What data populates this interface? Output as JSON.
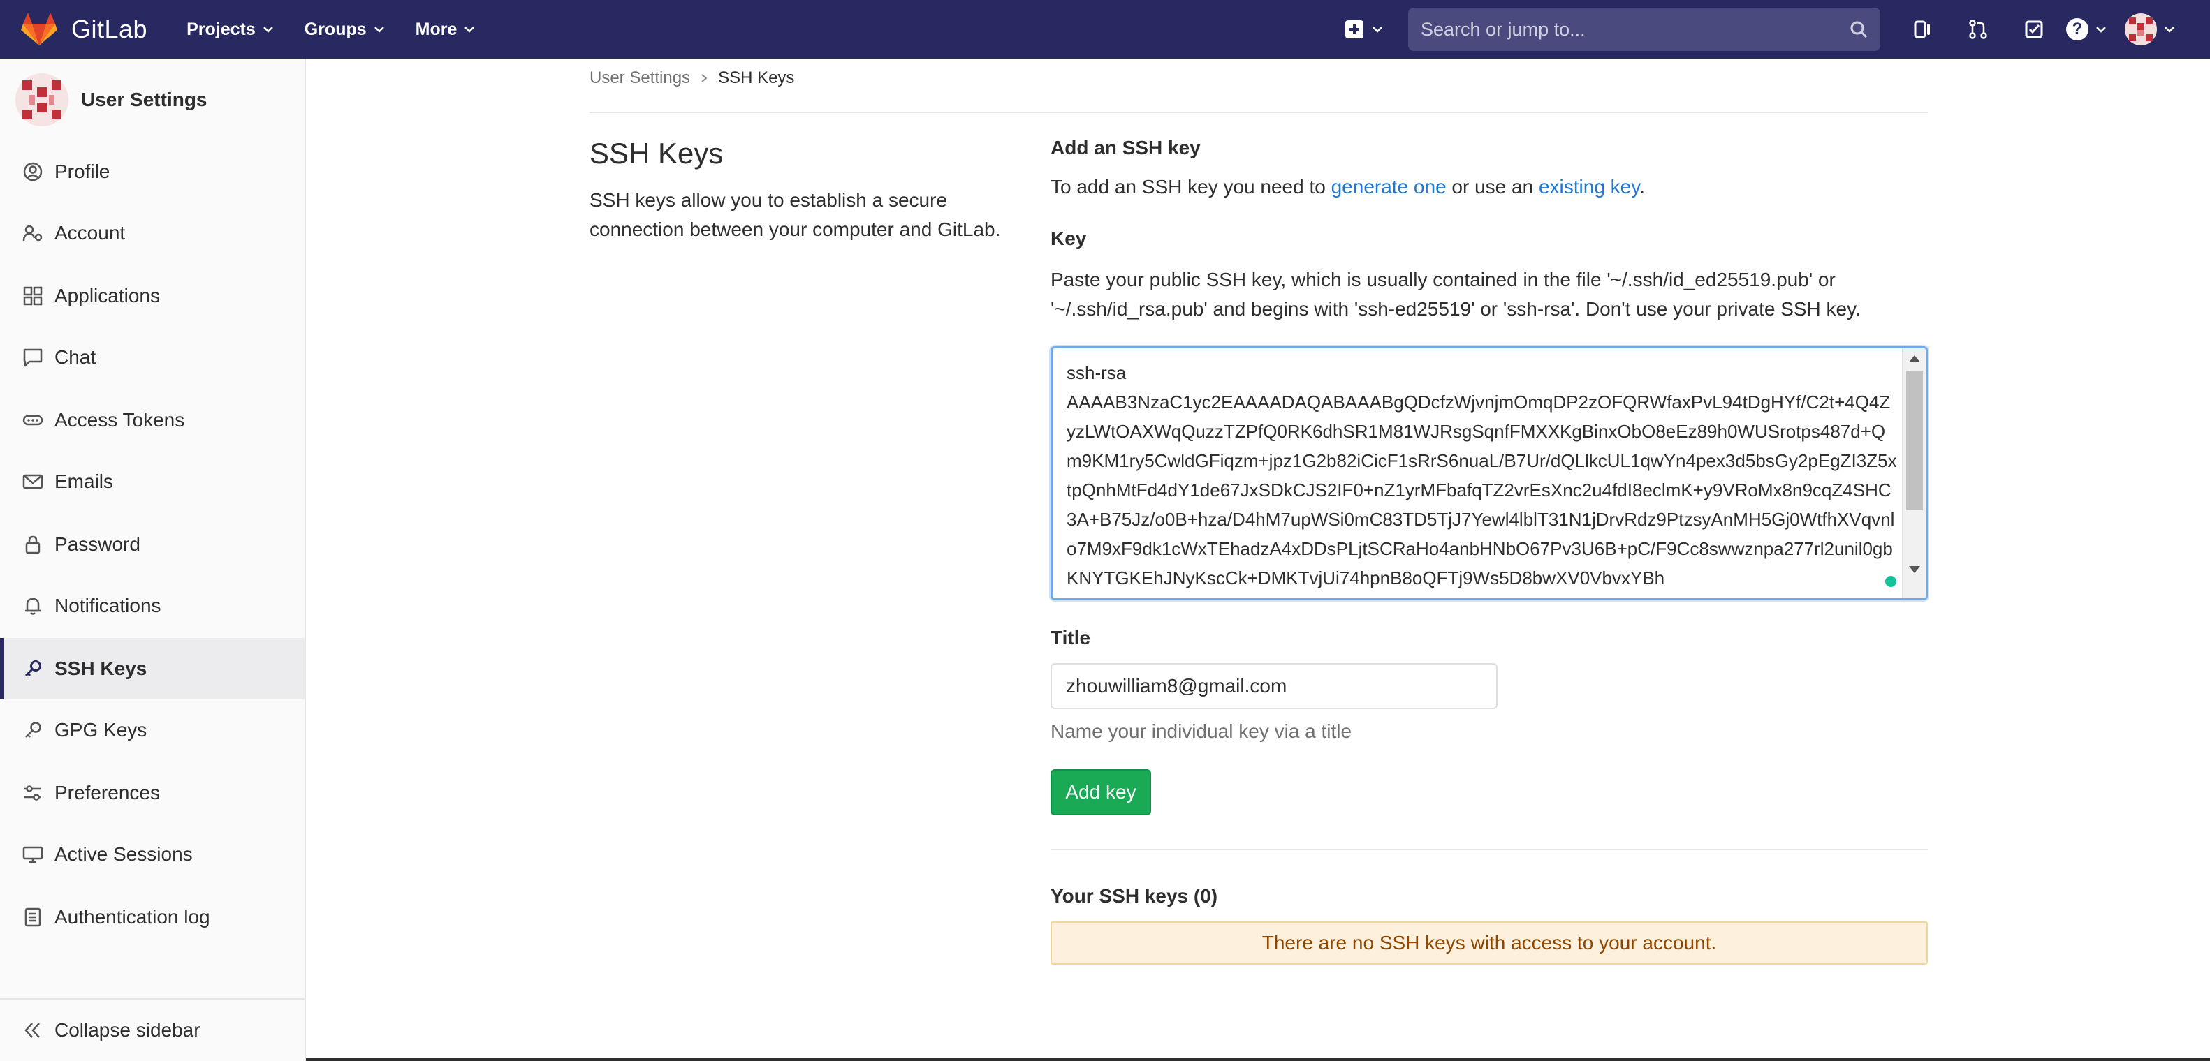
{
  "navbar": {
    "brand": "GitLab",
    "links": [
      {
        "label": "Projects",
        "icon": "chevron-down-icon"
      },
      {
        "label": "Groups",
        "icon": "chevron-down-icon"
      },
      {
        "label": "More",
        "icon": "chevron-down-icon"
      }
    ],
    "search_placeholder": "Search or jump to...",
    "help_glyph": "?"
  },
  "sidebar": {
    "title": "User Settings",
    "items": [
      {
        "label": "Profile",
        "icon": "profile-icon"
      },
      {
        "label": "Account",
        "icon": "account-icon"
      },
      {
        "label": "Applications",
        "icon": "applications-icon"
      },
      {
        "label": "Chat",
        "icon": "chat-icon"
      },
      {
        "label": "Access Tokens",
        "icon": "token-icon"
      },
      {
        "label": "Emails",
        "icon": "mail-icon"
      },
      {
        "label": "Password",
        "icon": "lock-icon"
      },
      {
        "label": "Notifications",
        "icon": "bell-icon"
      },
      {
        "label": "SSH Keys",
        "icon": "key-icon",
        "active": true
      },
      {
        "label": "GPG Keys",
        "icon": "key-icon"
      },
      {
        "label": "Preferences",
        "icon": "preferences-icon"
      },
      {
        "label": "Active Sessions",
        "icon": "monitor-icon"
      },
      {
        "label": "Authentication log",
        "icon": "log-icon"
      }
    ],
    "collapse_label": "Collapse sidebar"
  },
  "breadcrumb": {
    "parent": "User Settings",
    "current": "SSH Keys"
  },
  "page": {
    "title": "SSH Keys",
    "description": "SSH keys allow you to establish a secure connection between your computer and GitLab."
  },
  "form": {
    "heading": "Add an SSH key",
    "intro_prefix": "To add an SSH key you need to ",
    "intro_link1": "generate one",
    "intro_middle": " or use an ",
    "intro_link2": "existing key",
    "intro_suffix": ".",
    "key_label": "Key",
    "key_help": "Paste your public SSH key, which is usually contained in the file '~/.ssh/id_ed25519.pub' or '~/.ssh/id_rsa.pub' and begins with 'ssh-ed25519' or 'ssh-rsa'. Don't use your private SSH key.",
    "key_value": "ssh-rsa\nAAAAB3NzaC1yc2EAAAADAQABAAABgQDcfzWjvnjmOmqDP2zOFQRWfaxPvL94tDgHYf/C2t+4Q4ZyzLWtOAXWqQuzzTZPfQ0RK6dhSR1M81WJRsgSqnfFMXXKgBinxObO8eEz89h0WUSrotps487d+Qm9KM1ry5CwldGFiqzm+jpz1G2b82iCicF1sRrS6nuaL/B7Ur/dQLlkcUL1qwYn4pex3d5bsGy2pEgZI3Z5xtpQnhMtFd4dY1de67JxSDkCJS2IF0+nZ1yrMFbafqTZ2vrEsXnc2u4fdI8eclmK+y9VRoMx8n9cqZ4SHC3A+B75Jz/o0B+hza/D4hM7upWSi0mC83TD5TjJ7Yewl4lblT31N1jDrvRdz9PtzsyAnMH5Gj0WtfhXVqvnlo7M9xF9dk1cWxTEhadzA4xDDsPLjtSCRaHo4anbHNbO67Pv3U6B+pC/F9Cc8swwznpa277rl2unil0gbKNYTGKEhJNyKscCk+DMKTvjUi74hpnB8oQFTj9Ws5D8bwXV0VbvxYBh",
    "title_label": "Title",
    "title_value": "zhouwilliam8@gmail.com",
    "title_help": "Name your individual key via a title",
    "submit_label": "Add key"
  },
  "keys_list": {
    "heading": "Your SSH keys (0)",
    "empty_message": "There are no SSH keys with access to your account."
  },
  "colors": {
    "navbar_bg": "#292961",
    "link": "#1f78d1",
    "primary_button": "#1aaa55",
    "warning_bg": "#fdf1dd"
  }
}
